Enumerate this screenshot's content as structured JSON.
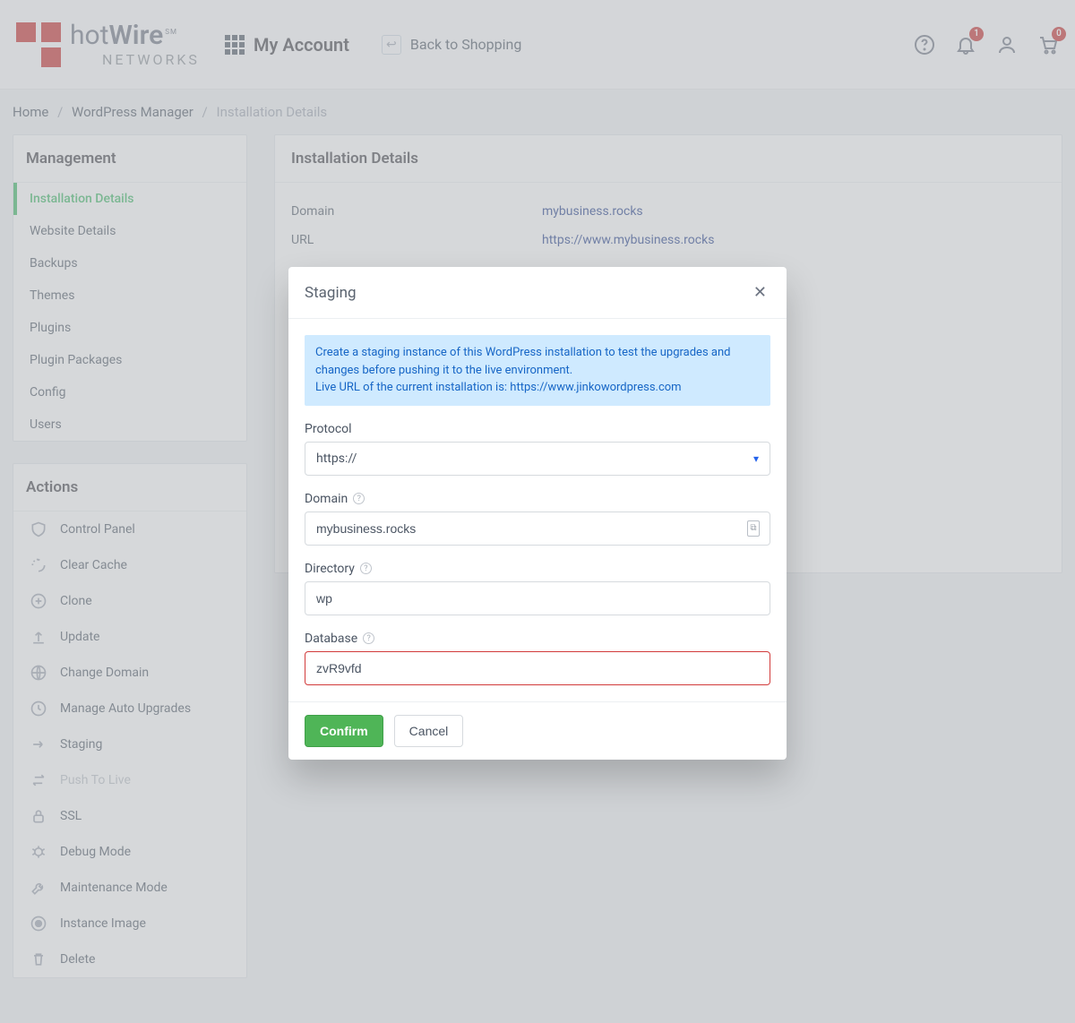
{
  "header": {
    "brand_line1_prefix": "hot",
    "brand_line1_suffix": "Wire",
    "brand_sm": "SM",
    "brand_line2": "NETWORKS",
    "my_account_label": "My Account",
    "back_label": "Back to Shopping",
    "notif_count": "1",
    "cart_count": "0"
  },
  "breadcrumb": {
    "items": [
      "Home",
      "WordPress Manager",
      "Installation Details"
    ]
  },
  "sidebar": {
    "management_title": "Management",
    "management_items": [
      {
        "label": "Installation Details",
        "active": true
      },
      {
        "label": "Website Details"
      },
      {
        "label": "Backups"
      },
      {
        "label": "Themes"
      },
      {
        "label": "Plugins"
      },
      {
        "label": "Plugin Packages"
      },
      {
        "label": "Config"
      },
      {
        "label": "Users"
      }
    ],
    "actions_title": "Actions",
    "actions_items": [
      {
        "label": "Control Panel",
        "icon": "shield"
      },
      {
        "label": "Clear Cache",
        "icon": "refresh"
      },
      {
        "label": "Clone",
        "icon": "plus-circle"
      },
      {
        "label": "Update",
        "icon": "upload"
      },
      {
        "label": "Change Domain",
        "icon": "globe"
      },
      {
        "label": "Manage Auto Upgrades",
        "icon": "history"
      },
      {
        "label": "Staging",
        "icon": "forward"
      },
      {
        "label": "Push To Live",
        "icon": "swap",
        "disabled": true
      },
      {
        "label": "SSL",
        "icon": "lock"
      },
      {
        "label": "Debug Mode",
        "icon": "bug"
      },
      {
        "label": "Maintenance Mode",
        "icon": "wrench"
      },
      {
        "label": "Instance Image",
        "icon": "record"
      },
      {
        "label": "Delete",
        "icon": "trash"
      }
    ]
  },
  "main": {
    "title": "Installation Details",
    "rows": [
      {
        "label": "Domain",
        "value": "mybusiness.rocks"
      },
      {
        "label": "URL",
        "value": "https://www.mybusiness.rocks"
      }
    ]
  },
  "modal": {
    "title": "Staging",
    "info_line1": "Create a staging instance of this WordPress installation to test the upgrades and changes before pushing it to the live environment.",
    "info_line2": "Live URL of the current installation is: https://www.jinkowordpress.com",
    "protocol_label": "Protocol",
    "protocol_value": "https://",
    "domain_label": "Domain",
    "domain_value": "mybusiness.rocks",
    "directory_label": "Directory",
    "directory_value": "wp",
    "database_label": "Database",
    "database_value": "zvR9vfd",
    "confirm_label": "Confirm",
    "cancel_label": "Cancel"
  }
}
